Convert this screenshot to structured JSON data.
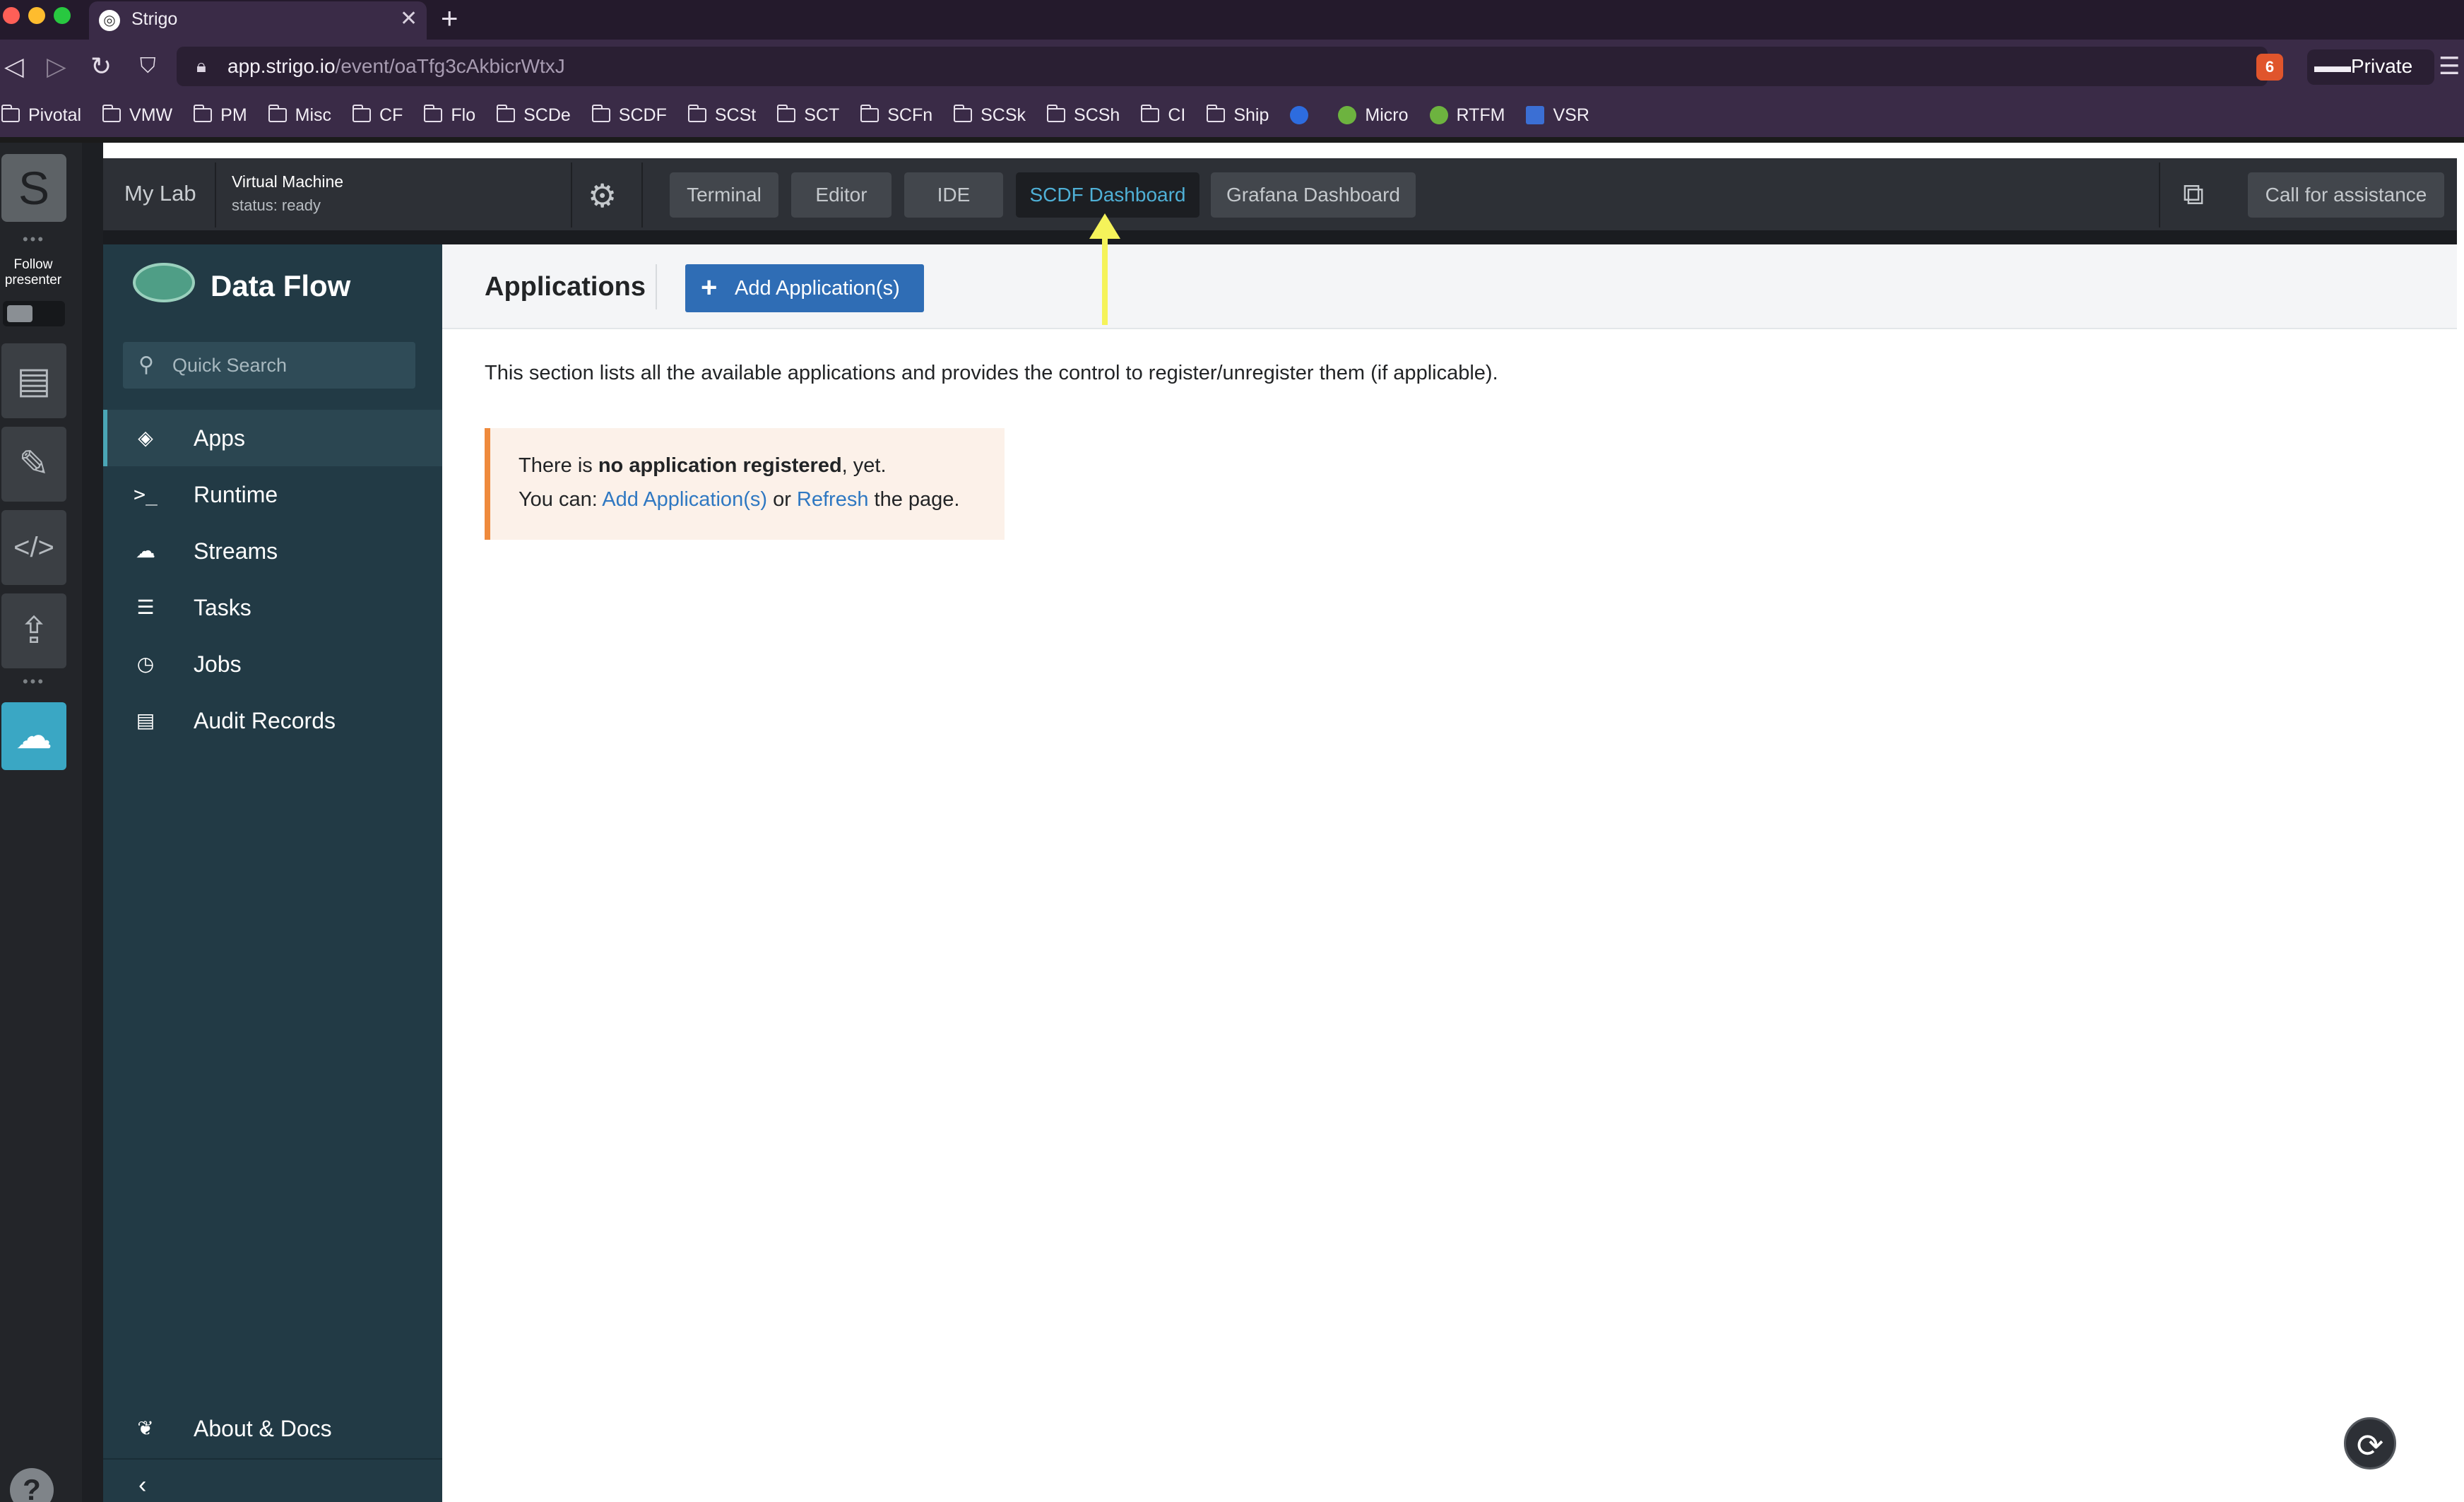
{
  "browser": {
    "tab_title": "Strigo",
    "url_host": "app.strigo.io",
    "url_path": "/event/oaTfg3cAkbicrWtxJ",
    "brave_count": "6",
    "private_label": "Private",
    "bookmarks": [
      {
        "label": "Pivotal",
        "type": "folder"
      },
      {
        "label": "VMW",
        "type": "folder"
      },
      {
        "label": "PM",
        "type": "folder"
      },
      {
        "label": "Misc",
        "type": "folder"
      },
      {
        "label": "CF",
        "type": "folder"
      },
      {
        "label": "Flo",
        "type": "folder"
      },
      {
        "label": "SCDe",
        "type": "folder"
      },
      {
        "label": "SCDF",
        "type": "folder"
      },
      {
        "label": "SCSt",
        "type": "folder"
      },
      {
        "label": "SCT",
        "type": "folder"
      },
      {
        "label": "SCFn",
        "type": "folder"
      },
      {
        "label": "SCSk",
        "type": "folder"
      },
      {
        "label": "SCSh",
        "type": "folder"
      },
      {
        "label": "CI",
        "type": "folder"
      },
      {
        "label": "Ship",
        "type": "folder"
      },
      {
        "label": "",
        "type": "clock-icon"
      },
      {
        "label": "Micro",
        "type": "spring-icon"
      },
      {
        "label": "RTFM",
        "type": "spring-leaf-icon"
      },
      {
        "label": "VSR",
        "type": "vmware-icon"
      }
    ]
  },
  "rail": {
    "avatar_letter": "S",
    "follow_label": "Follow presenter"
  },
  "labbar": {
    "my_lab": "My Lab",
    "vm_title": "Virtual Machine",
    "vm_status": "status: ready",
    "tabs": [
      "Terminal",
      "Editor",
      "IDE",
      "SCDF Dashboard",
      "Grafana Dashboard"
    ],
    "active_tab": "SCDF Dashboard",
    "assist_label": "Call for assistance"
  },
  "sidebar": {
    "title": "Data Flow",
    "search_placeholder": "Quick Search",
    "items": [
      {
        "label": "Apps",
        "icon": "tags-icon"
      },
      {
        "label": "Runtime",
        "icon": "terminal-icon"
      },
      {
        "label": "Streams",
        "icon": "cloud-icon"
      },
      {
        "label": "Tasks",
        "icon": "tasks-icon"
      },
      {
        "label": "Jobs",
        "icon": "clock-icon"
      },
      {
        "label": "Audit Records",
        "icon": "list-icon"
      }
    ],
    "active_item": "Apps",
    "about_label": "About & Docs"
  },
  "main": {
    "title": "Applications",
    "add_button_label": "Add Application(s)",
    "intro_text": "This section lists all the available applications and provides the control to register/unregister them (if applicable).",
    "alert": {
      "line1_prefix": "There is ",
      "line1_bold": "no application registered",
      "line1_suffix": ", yet.",
      "line2_prefix": "You can: ",
      "link_add": "Add Application(s)",
      "line2_or": " or ",
      "link_refresh": "Refresh",
      "line2_suffix": " the page."
    }
  },
  "colors": {
    "accent_blue": "#2f6db5",
    "active_tab_text": "#4fb0d6",
    "sidebar_bg": "#223a45",
    "alert_border": "#ef8a3c",
    "annotation_arrow": "#f5f35a"
  }
}
